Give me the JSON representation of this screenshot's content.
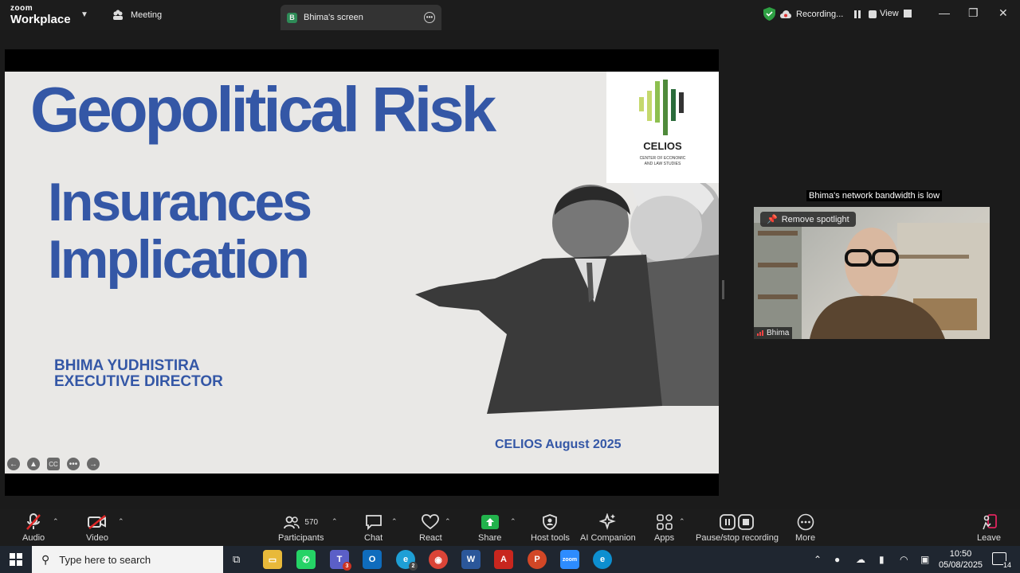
{
  "app": {
    "brand_top": "zoom",
    "brand_bottom": "Workplace"
  },
  "tabs": {
    "meeting": "Meeting",
    "screen": "Bhima's screen",
    "screen_badge": "B"
  },
  "recording": {
    "label": "Recording...",
    "view": "View"
  },
  "slide": {
    "title_line1": "Geopolitical Risk",
    "title_line2": "Insurances",
    "title_line3": "Implication",
    "speaker_name": "BHIMA YUDHISTIRA",
    "speaker_role": "EXECUTIVE DIRECTOR",
    "footer": "CELIOS August 2025",
    "logo_name": "CELIOS",
    "logo_sub_1": "CENTER OF ECONOMIC",
    "logo_sub_2": "AND LAW STUDIES",
    "colors": {
      "title": "#3457a6",
      "background": "#e9e8e6"
    }
  },
  "video": {
    "bandwidth_notice": "Bhima's network bandwidth is low",
    "spotlight_button": "Remove spotlight",
    "participant_name": "Bhima"
  },
  "toolbar": {
    "audio": "Audio",
    "video": "Video",
    "participants": "Participants",
    "participants_count": "570",
    "chat": "Chat",
    "react": "React",
    "share": "Share",
    "host_tools": "Host tools",
    "ai_companion": "AI Companion",
    "apps": "Apps",
    "pause_stop": "Pause/stop recording",
    "more": "More",
    "leave": "Leave"
  },
  "taskbar": {
    "search_placeholder": "Type here to search",
    "teams_badge": "3",
    "edge_badge": "2",
    "time": "10:50",
    "date": "05/08/2025",
    "notifications": "14"
  }
}
